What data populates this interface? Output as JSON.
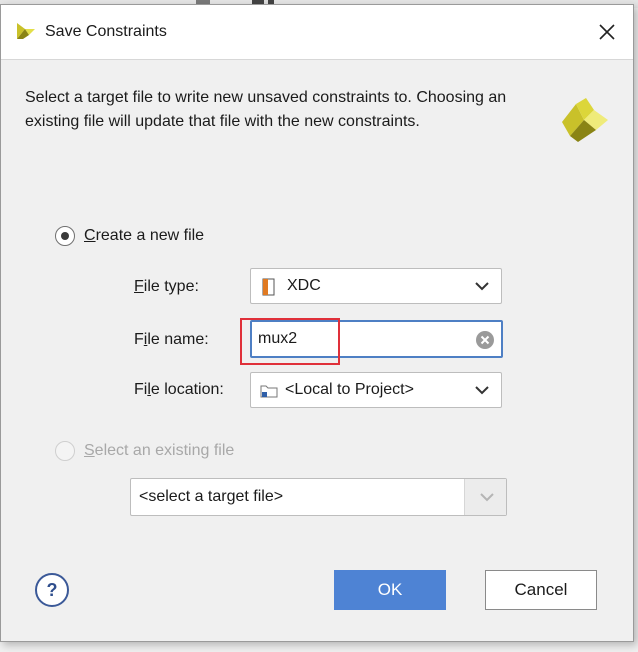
{
  "dialog": {
    "title": "Save Constraints",
    "description": "Select a target file to write new unsaved constraints to. Choosing an existing file will update that file with the new constraints."
  },
  "options": {
    "create_new": {
      "label": "Create a new file",
      "selected": true
    },
    "select_existing": {
      "label": "Select an existing file",
      "selected": false,
      "enabled": false
    }
  },
  "file_type": {
    "label": "File type:",
    "value": "XDC",
    "icon": "xdc-file-icon"
  },
  "file_name": {
    "label": "File name:",
    "value": "mux2"
  },
  "file_location": {
    "label": "File location:",
    "value": "<Local to Project>",
    "icon": "folder-icon"
  },
  "existing_file": {
    "placeholder": "<select a target file>"
  },
  "buttons": {
    "ok": "OK",
    "cancel": "Cancel",
    "help": "?"
  },
  "colors": {
    "accent": "#4e83d4",
    "focus_border": "#4e7fc4",
    "annotation": "#e0303a",
    "logo_yellow": "#c9c12a",
    "logo_dark": "#8a8414"
  }
}
